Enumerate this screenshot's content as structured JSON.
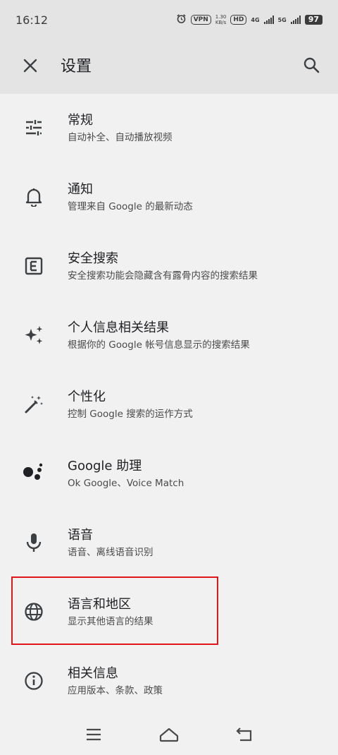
{
  "status_bar": {
    "time": "16:12",
    "vpn": "VPN",
    "speed_value": "1.30",
    "speed_unit": "KB/s",
    "hd": "HD",
    "net1": "4G",
    "net2": "5G",
    "battery": "97"
  },
  "header": {
    "title": "设置",
    "close_icon": "close-icon",
    "search_icon": "search-icon"
  },
  "settings": [
    {
      "label": "常规",
      "sub": "自动补全、自动播放视频",
      "icon": "tune-sliders-icon"
    },
    {
      "label": "通知",
      "sub": "管理来自 Google 的最新动态",
      "icon": "bell-icon"
    },
    {
      "label": "安全搜索",
      "sub": "安全搜索功能会隐藏含有露骨内容的搜索结果",
      "icon": "explicit-e-icon"
    },
    {
      "label": "个人信息相关结果",
      "sub": "根据你的 Google 帐号信息显示的搜索结果",
      "icon": "sparkle-icon"
    },
    {
      "label": "个性化",
      "sub": "控制 Google 搜索的运作方式",
      "icon": "magic-wand-icon"
    },
    {
      "label": "Google 助理",
      "sub": "Ok Google、Voice Match",
      "icon": "assistant-dots-icon"
    },
    {
      "label": "语音",
      "sub": "语音、离线语音识别",
      "icon": "microphone-icon"
    },
    {
      "label": "语言和地区",
      "sub": "显示其他语言的结果",
      "icon": "globe-icon"
    },
    {
      "label": "相关信息",
      "sub": "应用版本、条款、政策",
      "icon": "info-icon"
    }
  ],
  "colors": {
    "highlight_border": "#e0161b",
    "header_bg": "#e4e4e4",
    "page_bg": "#f1f1f1"
  },
  "nav_bar": {
    "menu_icon": "menu-icon",
    "home_icon": "home-icon",
    "back_icon": "back-icon"
  }
}
